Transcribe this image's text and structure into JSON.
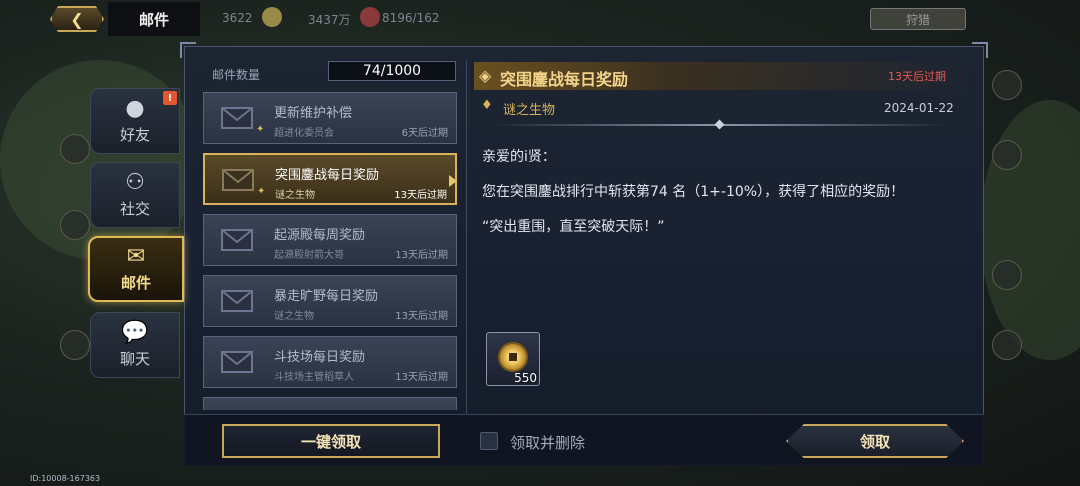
{
  "topbar": {
    "title": "邮件",
    "resources": [
      "3622",
      "3437万",
      "8196/162"
    ],
    "right_button": "狩猎"
  },
  "tabs": [
    {
      "label": "好友",
      "icon": "friend-icon",
      "badge": "!"
    },
    {
      "label": "社交",
      "icon": "social-icon"
    },
    {
      "label": "邮件",
      "icon": "mail-icon",
      "active": true
    },
    {
      "label": "聊天",
      "icon": "chat-icon"
    }
  ],
  "mail_list": {
    "count_label": "邮件数量",
    "count_value": "74/1000",
    "items": [
      {
        "title": "更新维护补偿",
        "sender": "超进化委员会",
        "expiry": "6天后过期"
      },
      {
        "title": "突围鏖战每日奖励",
        "sender": "谜之生物",
        "expiry": "13天后过期",
        "active": true
      },
      {
        "title": "起源殿每周奖励",
        "sender": "起源殿射箭大哥",
        "expiry": "13天后过期"
      },
      {
        "title": "暴走旷野每日奖励",
        "sender": "谜之生物",
        "expiry": "13天后过期"
      },
      {
        "title": "斗技场每日奖励",
        "sender": "斗技场主管稻草人",
        "expiry": "13天后过期"
      }
    ]
  },
  "detail": {
    "title": "突围鏖战每日奖励",
    "expiry": "13天后过期",
    "sender": "谜之生物",
    "date": "2024-01-22",
    "greeting": "亲爱的i贤：",
    "body": "您在突围鏖战排行中斩获第74 名（1+-10%），获得了相应的奖励！",
    "quote": "“突出重围，直至突破天际！”",
    "reward": {
      "icon": "coin-icon",
      "amount": "550"
    }
  },
  "bottom": {
    "claim_all": "一键领取",
    "claim_and_delete": "领取并删除",
    "claim": "领取"
  },
  "player_id": "ID:10008-167363",
  "colors": {
    "gold": "#d9b25a",
    "expiry_red": "#e85a50",
    "panel_bg": "#1d2533"
  }
}
